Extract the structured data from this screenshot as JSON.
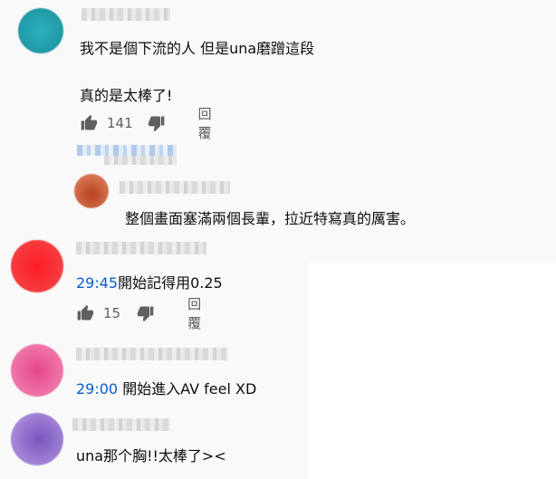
{
  "comments": [
    {
      "text_line1": "我不是個下流的人 但是una磨蹭這段",
      "text_line2": "真的是太棒了!",
      "likes": "141",
      "reply_label": "回覆",
      "avatar_color": "#26a6b4"
    },
    {
      "text": "整個畫面塞滿兩個長輩，拉近特寫真的厲害。",
      "avatar_color": "#c9512a"
    },
    {
      "timestamp": "29:45",
      "text": "開始記得用0.25",
      "likes": "15",
      "reply_label": "回覆",
      "avatar_color": "#f0282d"
    },
    {
      "timestamp": "29:00",
      "text": " 開始進入AV feel XD",
      "avatar_color": "#e25a93"
    },
    {
      "text": "una那个胸!!太棒了>< ",
      "avatar_color": "#8a6bc6"
    }
  ],
  "icons": [
    "like-icon",
    "dislike-icon"
  ],
  "colors": {
    "timestamp_link": "#065fd4",
    "secondary_text": "#606060"
  }
}
